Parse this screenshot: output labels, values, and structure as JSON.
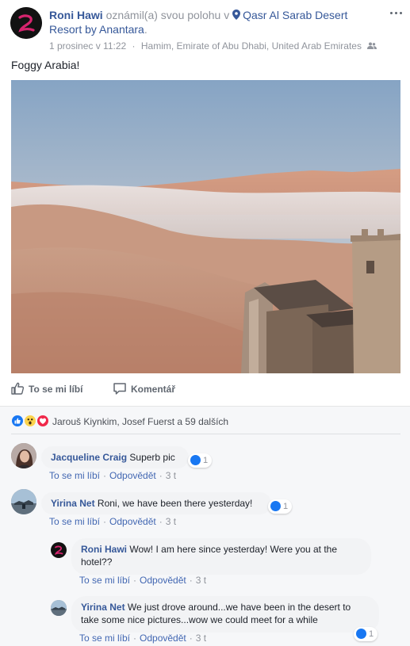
{
  "post": {
    "author": "Roni Hawi",
    "action_text": "oznámil(a) svou polohu v",
    "location": "Qasr Al Sarab Desert Resort by Anantara",
    "location_suffix": ".",
    "date": "1 prosinec v 11:22",
    "separator": "·",
    "place": "Hamim, Emirate of Abu Dhabi, United Arab Emirates",
    "privacy_icon": "friends-icon",
    "text": "Foggy Arabia!",
    "photo_description_icon": "desert-photo"
  },
  "actions": {
    "like_label": "To se mi líbí",
    "comment_label": "Komentář"
  },
  "reactions": {
    "types": [
      "like",
      "wow",
      "love"
    ],
    "summary": "Jarouš Kiynkim, Josef Fuerst a 59 dalších"
  },
  "comments": [
    {
      "author": "Jacqueline Craig",
      "text": "Superb pic",
      "likes": "1",
      "like_link": "To se mi líbí",
      "reply_link": "Odpovědět",
      "time": "3 t"
    },
    {
      "author": "Yirina Net",
      "text": "Roni, we have been there yesterday!",
      "likes": "1",
      "like_link": "To se mi líbí",
      "reply_link": "Odpovědět",
      "time": "3 t"
    },
    {
      "author": "Roni Hawi",
      "text": "Wow! I am here since yesterday! Were you at the hotel??",
      "like_link": "To se mi líbí",
      "reply_link": "Odpovědět",
      "time": "3 t"
    },
    {
      "author": "Yirina Net",
      "text": "We just drove around...we have been in the desert to take some nice pictures...wow we could meet for a while",
      "likes": "1",
      "like_link": "To se mi líbí",
      "reply_link": "Odpovědět",
      "time": "3 t"
    }
  ],
  "colors": {
    "link": "#365899",
    "muted": "#90949c",
    "like_blue": "#1877f2",
    "bubble": "#f2f3f5"
  }
}
